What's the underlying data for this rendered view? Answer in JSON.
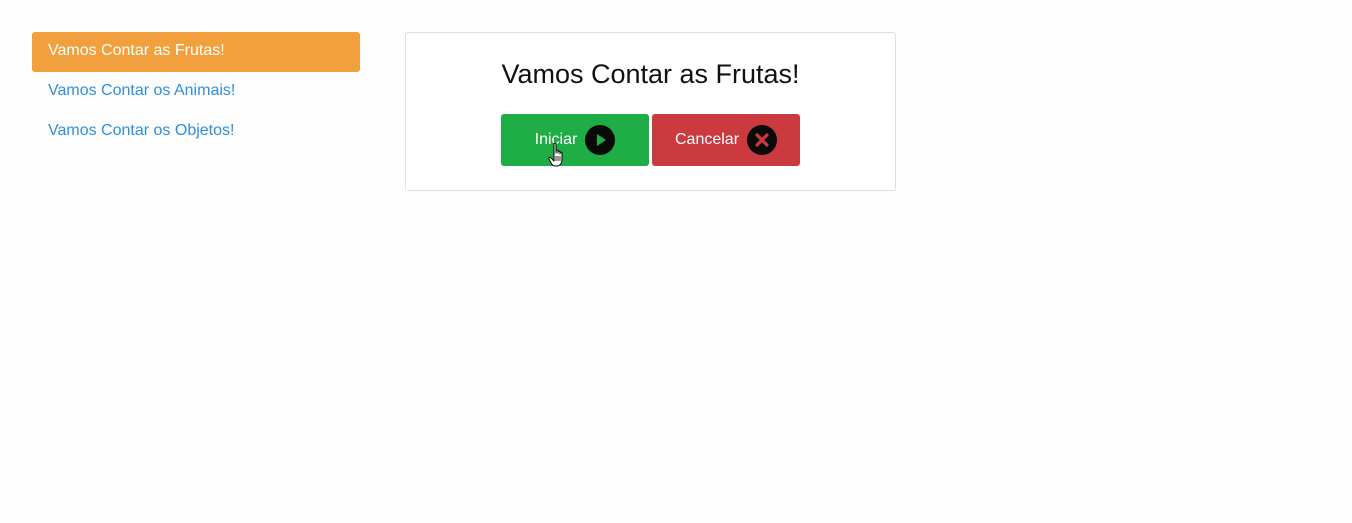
{
  "sidebar": {
    "items": [
      {
        "label": "Vamos Contar as Frutas!",
        "active": true
      },
      {
        "label": "Vamos Contar os Animais!",
        "active": false
      },
      {
        "label": "Vamos Contar os Objetos!",
        "active": false
      }
    ]
  },
  "main": {
    "title": "Vamos Contar as Frutas!",
    "start_label": "Iniciar",
    "start_icon": "play-icon",
    "cancel_label": "Cancelar",
    "cancel_icon": "close-icon"
  },
  "colors": {
    "active_nav": "#f2a03d",
    "link": "#2f8fdb",
    "start_button": "#1eae45",
    "cancel_button": "#cb3a3e"
  }
}
